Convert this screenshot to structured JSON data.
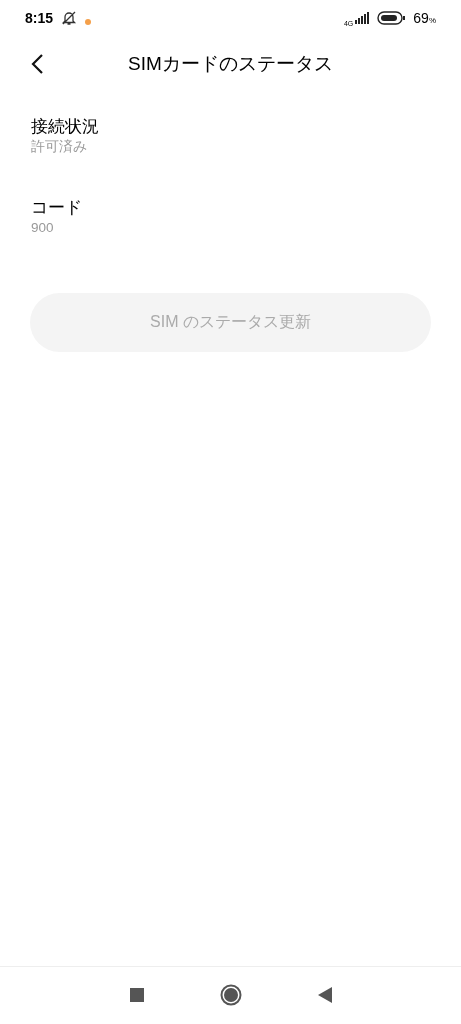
{
  "status_bar": {
    "time": "8:15",
    "network": "4G",
    "battery": "69",
    "battery_unit": "%"
  },
  "header": {
    "title": "SIMカードのステータス"
  },
  "items": [
    {
      "label": "接続状況",
      "value": "許可済み"
    },
    {
      "label": "コード",
      "value": "900"
    }
  ],
  "button": {
    "label": "SIM のステータス更新",
    "disabled": true
  }
}
